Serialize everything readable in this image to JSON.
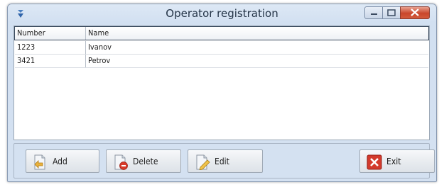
{
  "window": {
    "title": "Operator registration"
  },
  "table": {
    "columns": [
      "Number",
      "Name"
    ],
    "rows": [
      {
        "number": "1223",
        "name": "Ivanov"
      },
      {
        "number": "3421",
        "name": "Petrov"
      }
    ]
  },
  "buttons": {
    "add": "Add",
    "delete": "Delete",
    "edit": "Edit",
    "exit": "Exit"
  },
  "icons": {
    "app": "app-icon",
    "add": "add-document-icon",
    "delete": "delete-document-icon",
    "edit": "edit-document-icon",
    "exit": "close-x-icon"
  },
  "colors": {
    "title_bar": "#d2e0f1",
    "close_button": "#c9462b",
    "exit_icon": "#d33a2c"
  }
}
